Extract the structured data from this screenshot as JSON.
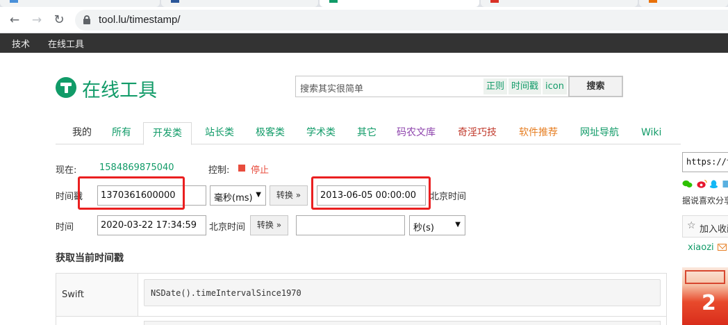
{
  "browser": {
    "url": "tool.lu/timestamp/"
  },
  "topbar": {
    "links": [
      "技术",
      "在线工具"
    ]
  },
  "header": {
    "logo_text": "在线工具",
    "search": {
      "placeholder": "搜索其实很简单",
      "chips": [
        "正则",
        "时间戳",
        "icon"
      ],
      "button_label": "搜索"
    }
  },
  "nav": {
    "tabs": [
      {
        "label": "我的",
        "color": "#333333",
        "active": false
      },
      {
        "label": "所有",
        "color": "#119b68",
        "active": false
      },
      {
        "label": "开发类",
        "color": "#119b68",
        "active": true
      },
      {
        "label": "站长类",
        "color": "#119b68",
        "active": false
      },
      {
        "label": "极客类",
        "color": "#119b68",
        "active": false
      },
      {
        "label": "学术类",
        "color": "#119b68",
        "active": false
      },
      {
        "label": "其它",
        "color": "#119b68",
        "active": false
      },
      {
        "label": "码农文库",
        "color": "#8e44ad",
        "active": false
      },
      {
        "label": "奇淫巧技",
        "color": "#c0392b",
        "active": false
      },
      {
        "label": "软件推荐",
        "color": "#e67e22",
        "active": false
      },
      {
        "label": "网址导航",
        "color": "#119b68",
        "active": false
      },
      {
        "label": "Wiki",
        "color": "#119b68",
        "active": false
      }
    ]
  },
  "status": {
    "now_label": "现在:",
    "now_value": "1584869875040",
    "control_label": "控制:",
    "stop_label": "停止"
  },
  "ts_to_date": {
    "label": "时间戳",
    "timestamp_value": "1370361600000",
    "unit_value": "毫秒(ms)",
    "convert_label": "转换 »",
    "result_value": "2013-06-05 00:00:00",
    "tz_label": "北京时间"
  },
  "date_to_ts": {
    "label": "时间",
    "date_value": "2020-03-22 17:34:59",
    "tz_label": "北京时间",
    "convert_label": "转换 »",
    "result_value": "",
    "unit_value": "秒(s)"
  },
  "section": {
    "title": "获取当前时间戳",
    "rows": [
      {
        "lang": "Swift",
        "code": "NSDate().timeIntervalSince1970"
      }
    ]
  },
  "sidebar": {
    "url_text": "https://to",
    "share_text": "据说喜欢分享",
    "favorite_label": "加入收藏",
    "user": "xiaozi"
  },
  "colors": {
    "brand": "#119b68",
    "highlight_box": "#ea1f20",
    "topbar": "#333333"
  }
}
